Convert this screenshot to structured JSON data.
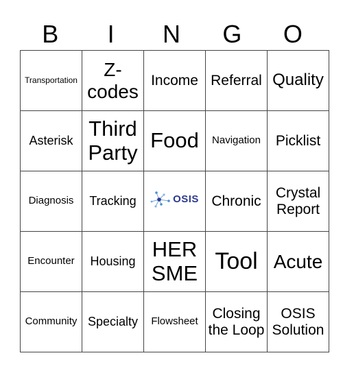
{
  "header": [
    "B",
    "I",
    "N",
    "G",
    "O"
  ],
  "logo": {
    "text": "OSIS",
    "color": "#2b3a8f",
    "accent": "#4a8fd0"
  },
  "rows": [
    [
      "Transportation",
      "Z-codes",
      "Income",
      "Referral",
      "Quality"
    ],
    [
      "Asterisk",
      "Third Party",
      "Food",
      "Navigation",
      "Picklist"
    ],
    [
      "Diagnosis",
      "Tracking",
      "",
      "Chronic",
      "Crystal Report"
    ],
    [
      "Encounter",
      "Housing",
      "HER SME",
      "Tool",
      "Acute"
    ],
    [
      "Community",
      "Specialty",
      "Flowsheet",
      "Closing the Loop",
      "OSIS Solution"
    ]
  ]
}
